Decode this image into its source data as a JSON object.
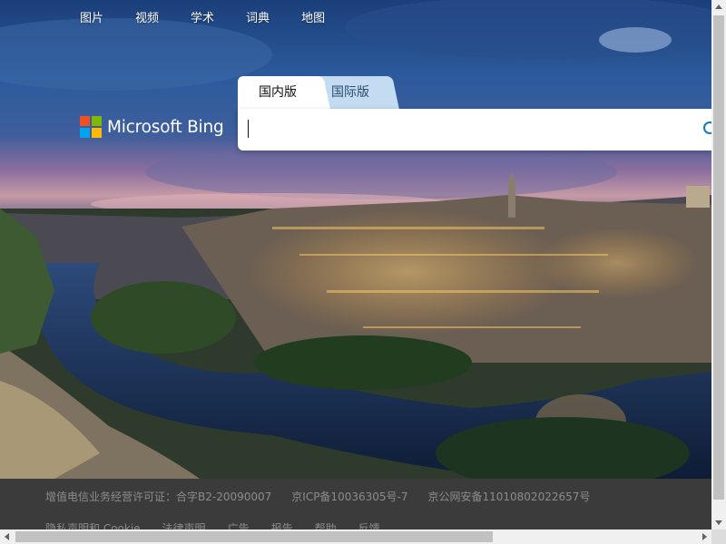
{
  "topnav": {
    "items": [
      {
        "label": "图片"
      },
      {
        "label": "视频"
      },
      {
        "label": "学术"
      },
      {
        "label": "词典"
      },
      {
        "label": "地图"
      }
    ]
  },
  "logo": {
    "text": "Microsoft Bing"
  },
  "tabs": {
    "domestic": "国内版",
    "international": "国际版",
    "active": "domestic"
  },
  "search": {
    "value": "",
    "placeholder": ""
  },
  "footer": {
    "licenses": [
      "增值电信业务经营许可证：合字B2-20090007",
      "京ICP备10036305号-7",
      "京公网安备11010802022657号"
    ],
    "links": [
      "隐私声明和 Cookie",
      "法律声明",
      "广告",
      "报告",
      "帮助",
      "反馈"
    ]
  },
  "colors": {
    "ms_red": "#f25022",
    "ms_green": "#7fba00",
    "ms_blue": "#00a4ef",
    "ms_yellow": "#ffb900",
    "search_accent": "#0f7ec0",
    "footer_bg": "#3b3b3b"
  },
  "icons": [
    "microsoft-logo-icon",
    "search-icon"
  ]
}
